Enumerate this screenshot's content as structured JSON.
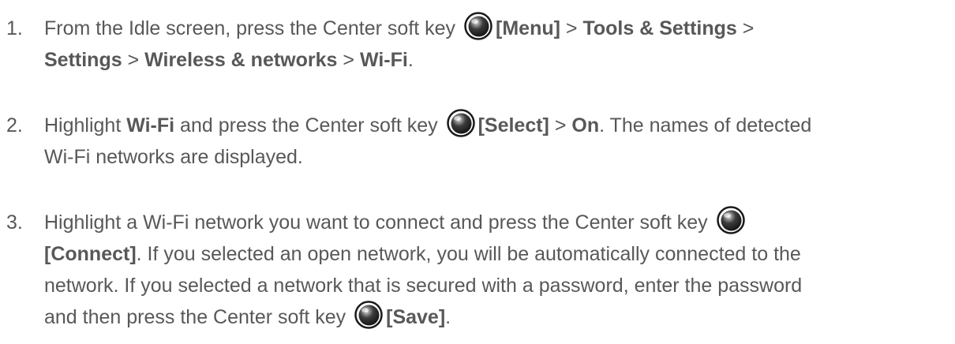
{
  "steps": [
    {
      "number": "1.",
      "line1": {
        "t1": "From the Idle screen, press the Center soft key ",
        "b1": "[Menu]",
        "t2": " > ",
        "b2": "Tools & Settings",
        "t3": " >"
      },
      "line2": {
        "b1": "Settings",
        "t1": " > ",
        "b2": "Wireless & networks",
        "t2": " > ",
        "b3": "Wi-Fi",
        "t3": "."
      }
    },
    {
      "number": "2.",
      "line1": {
        "t1": "Highlight ",
        "b1": "Wi-Fi",
        "t2": " and press the Center soft key ",
        "b2": "[Select]",
        "t3": " > ",
        "b3": "On",
        "t4": ". The names of detected"
      },
      "line2": {
        "t1": "Wi-Fi networks are displayed."
      }
    },
    {
      "number": "3.",
      "line1": {
        "t1": "Highlight a Wi-Fi network you want to connect and press the Center soft key "
      },
      "line2": {
        "b1": "[Connect]",
        "t1": ". If you selected an open network, you will be automatically connected to the"
      },
      "line3": {
        "t1": "network. If you selected a network that is secured with a password, enter the password"
      },
      "line4": {
        "t1": "and then press the Center soft key ",
        "b1": "[Save]",
        "t2": "."
      }
    }
  ],
  "icon": {
    "name": "center-soft-key-icon",
    "color_dark": "#1a1a1a",
    "color_highlight": "#e8e8e8"
  }
}
